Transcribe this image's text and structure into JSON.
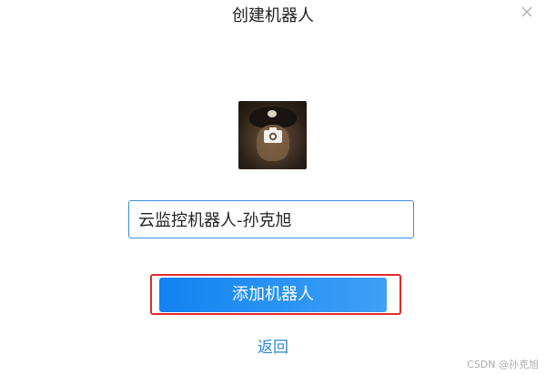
{
  "dialog": {
    "title": "创建机器人",
    "close_icon": "close-icon",
    "avatar_icon": "camera-icon",
    "name_input": {
      "value": "云监控机器人-孙克旭"
    },
    "primary_button_label": "添加机器人",
    "back_link_label": "返回",
    "watermark": "CSDN @孙克旭"
  },
  "colors": {
    "accent": "#1282f3",
    "highlight_border": "#e02b2b",
    "link": "#2f86c9"
  }
}
